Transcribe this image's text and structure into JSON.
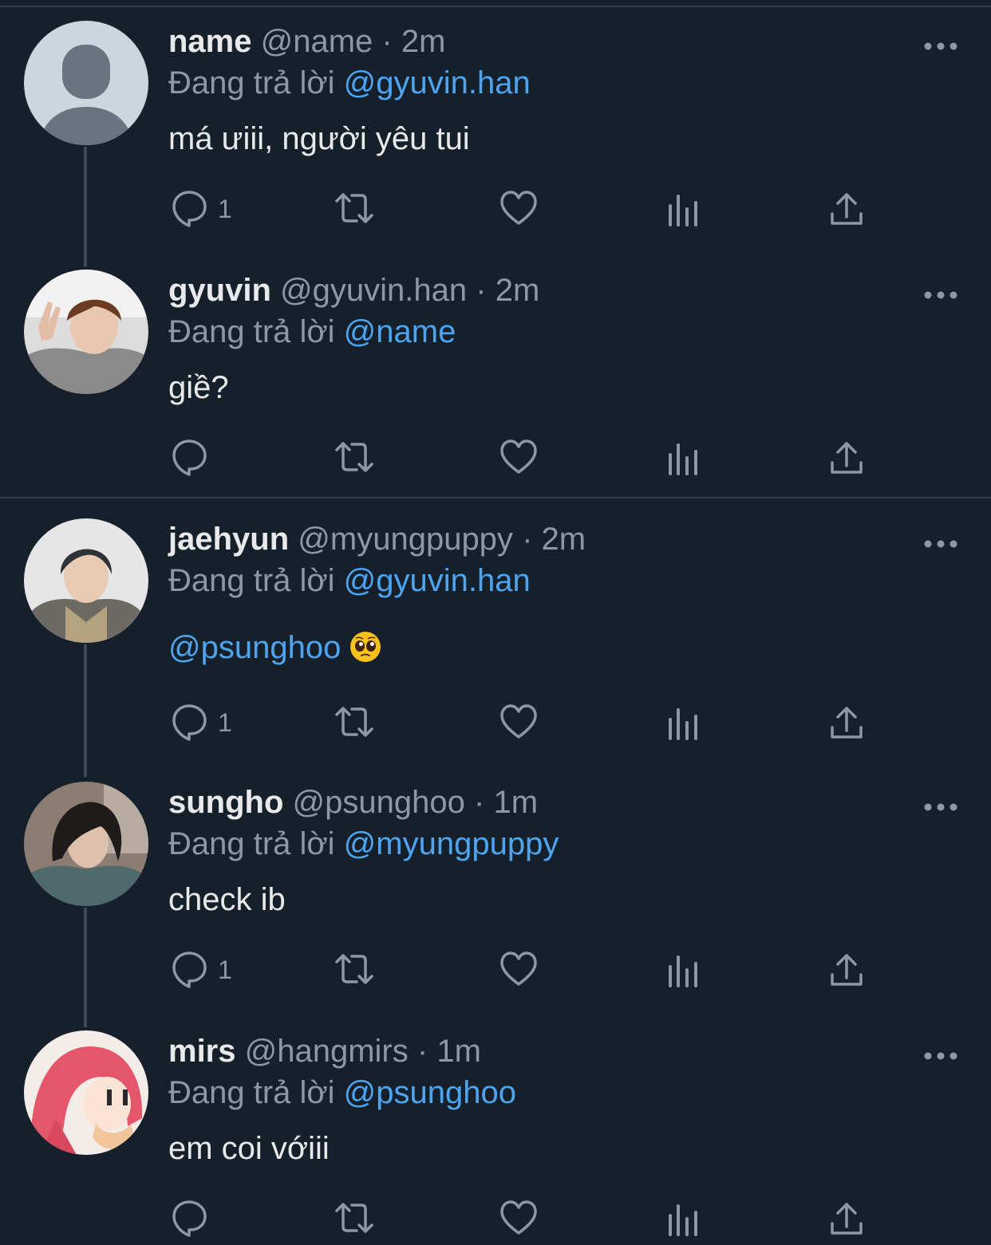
{
  "colors": {
    "background": "#15202b",
    "text": "#e7e9ea",
    "secondary": "#8b98a5",
    "mention": "#4ea4ee",
    "divider": "#2f3b47"
  },
  "reply_prefix": "Đang trả lời",
  "tweets": [
    {
      "display_name": "name",
      "handle": "@name",
      "time": "2m",
      "replying_to": "@gyuvin.han",
      "text": "má ưiii, người yêu tui",
      "reply_count": "1",
      "avatar": "default-avatar"
    },
    {
      "display_name": "gyuvin",
      "handle": "@gyuvin.han",
      "time": "2m",
      "replying_to": "@name",
      "text": "giề?",
      "reply_count": "",
      "avatar": "photo-avatar"
    },
    {
      "display_name": "jaehyun",
      "handle": "@myungpuppy",
      "time": "2m",
      "replying_to": "@gyuvin.han",
      "text_mention": "@psunghoo",
      "text_emoji": "pleading-face-emoji",
      "reply_count": "1",
      "avatar": "photo-avatar"
    },
    {
      "display_name": "sungho",
      "handle": "@psunghoo",
      "time": "1m",
      "replying_to": "@myungpuppy",
      "text": "check ib",
      "reply_count": "1",
      "avatar": "photo-avatar"
    },
    {
      "display_name": "mirs",
      "handle": "@hangmirs",
      "time": "1m",
      "replying_to": "@psunghoo",
      "text": "em coi vớiii",
      "reply_count": "",
      "avatar": "anime-avatar"
    }
  ]
}
